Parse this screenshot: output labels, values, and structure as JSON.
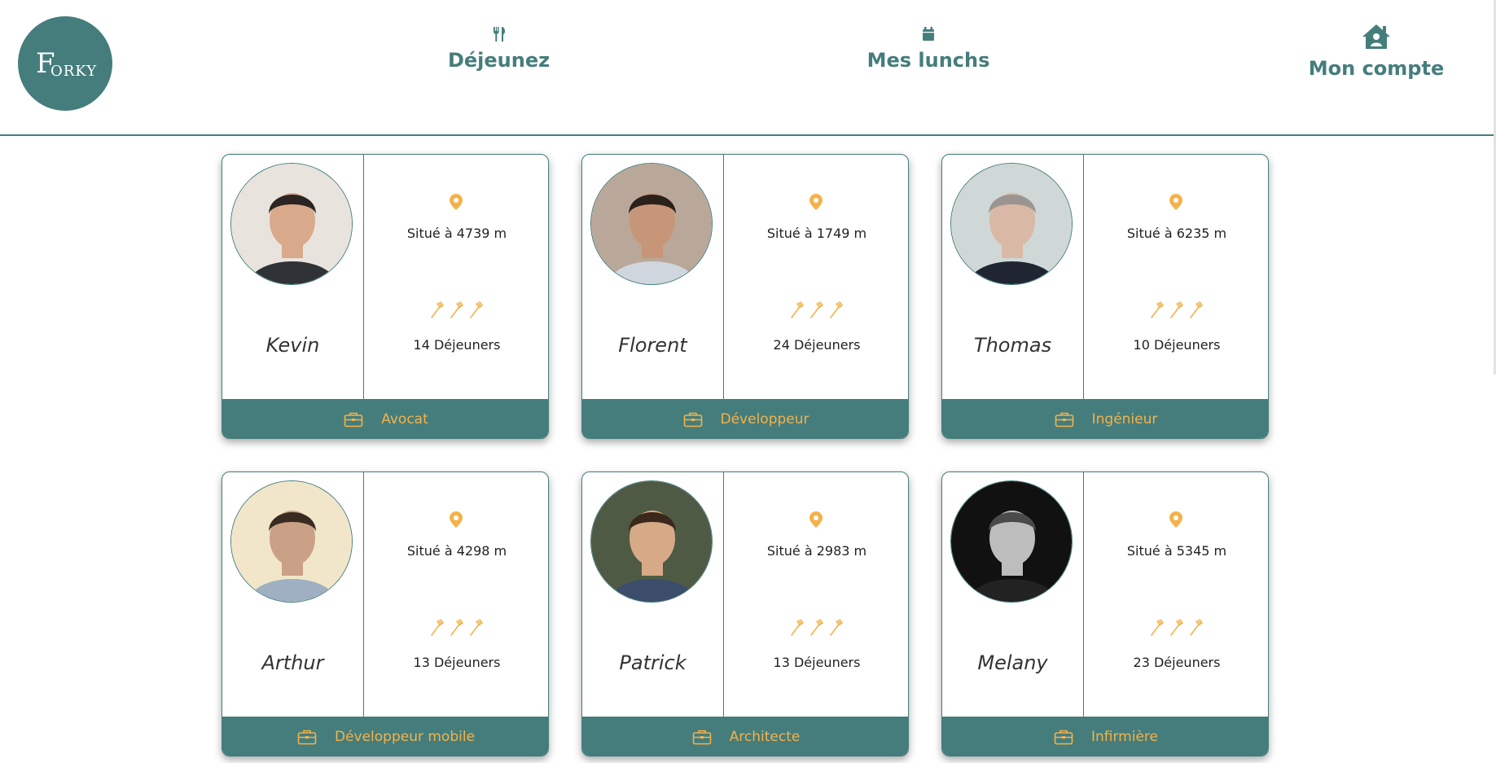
{
  "brand": {
    "logo_text": "FORKY",
    "color": "#457d7c",
    "accent": "#f4b24a"
  },
  "nav": [
    {
      "label": "Déjeunez",
      "icon": "utensils-icon"
    },
    {
      "label": "Mes lunchs",
      "icon": "calendar-icon"
    },
    {
      "label": "Mon compte",
      "icon": "home-user-icon"
    }
  ],
  "cards": [
    {
      "name": "Kevin",
      "distance": "Situé à 4739 m",
      "lunches": "14 Déjeuners",
      "job": "Avocat"
    },
    {
      "name": "Florent",
      "distance": "Situé à 1749 m",
      "lunches": "24 Déjeuners",
      "job": "Développeur"
    },
    {
      "name": "Thomas",
      "distance": "Situé à 6235 m",
      "lunches": "10 Déjeuners",
      "job": "Ingénieur"
    },
    {
      "name": "Arthur",
      "distance": "Situé à 4298 m",
      "lunches": "13 Déjeuners",
      "job": "Développeur mobile"
    },
    {
      "name": "Patrick",
      "distance": "Situé à 2983 m",
      "lunches": "13 Déjeuners",
      "job": "Architecte"
    },
    {
      "name": "Melany",
      "distance": "Situé à 5345 m",
      "lunches": "23 Déjeuners",
      "job": "Infirmière"
    }
  ]
}
